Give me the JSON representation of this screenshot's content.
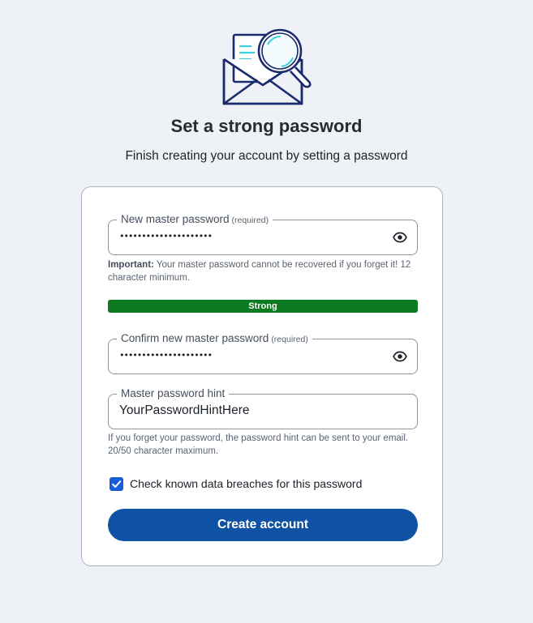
{
  "header": {
    "illustration_icon": "envelope-magnifier-icon",
    "title": "Set a strong password",
    "subtitle": "Finish creating your account by setting a password"
  },
  "form": {
    "new_password": {
      "label": "New master password",
      "required_label": "(required)",
      "value": "•••••••••••••••••••••",
      "toggle_icon": "eye-icon"
    },
    "important_note": {
      "prefix": "Important:",
      "text": "Your master password cannot be recovered if you forget it! 12 character minimum."
    },
    "strength": {
      "label": "Strong",
      "fill_fraction": 1.0,
      "color": "#0c7a20"
    },
    "confirm_password": {
      "label": "Confirm new master password",
      "required_label": "(required)",
      "value": "•••••••••••••••••••••",
      "toggle_icon": "eye-icon"
    },
    "hint": {
      "label": "Master password hint",
      "value": "YourPasswordHintHere",
      "help_text": "If you forget your password, the password hint can be sent to your email. 20/50 character maximum."
    },
    "breach_check": {
      "label": "Check known data breaches for this password",
      "checked": true
    },
    "submit_label": "Create account"
  },
  "colors": {
    "background": "#eef2f7",
    "primary_button": "#0f52a3",
    "checkbox": "#175ddc",
    "strength_strong": "#0c7a20"
  }
}
